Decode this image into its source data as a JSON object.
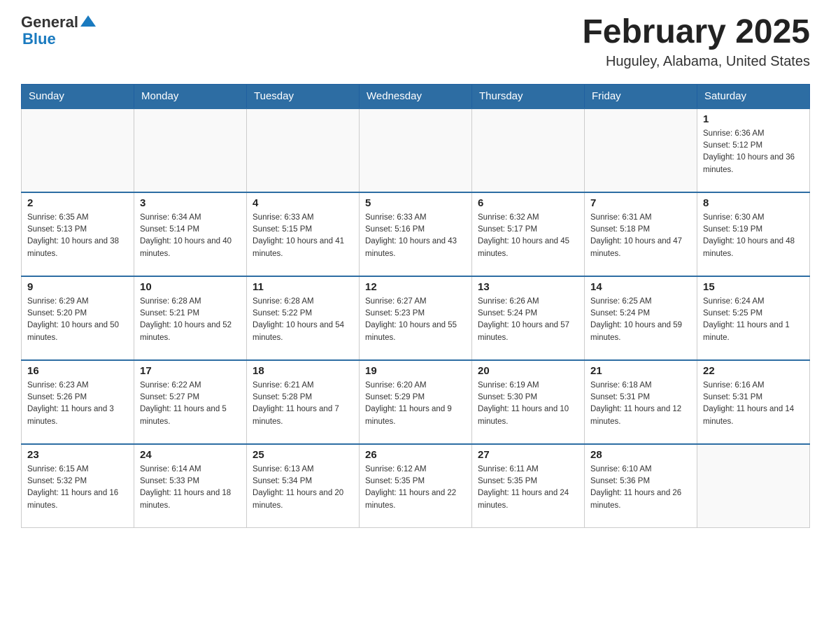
{
  "header": {
    "logo_general": "General",
    "logo_blue": "Blue",
    "month_title": "February 2025",
    "location": "Huguley, Alabama, United States"
  },
  "weekdays": [
    "Sunday",
    "Monday",
    "Tuesday",
    "Wednesday",
    "Thursday",
    "Friday",
    "Saturday"
  ],
  "weeks": [
    [
      {
        "day": "",
        "sunrise": "",
        "sunset": "",
        "daylight": ""
      },
      {
        "day": "",
        "sunrise": "",
        "sunset": "",
        "daylight": ""
      },
      {
        "day": "",
        "sunrise": "",
        "sunset": "",
        "daylight": ""
      },
      {
        "day": "",
        "sunrise": "",
        "sunset": "",
        "daylight": ""
      },
      {
        "day": "",
        "sunrise": "",
        "sunset": "",
        "daylight": ""
      },
      {
        "day": "",
        "sunrise": "",
        "sunset": "",
        "daylight": ""
      },
      {
        "day": "1",
        "sunrise": "Sunrise: 6:36 AM",
        "sunset": "Sunset: 5:12 PM",
        "daylight": "Daylight: 10 hours and 36 minutes."
      }
    ],
    [
      {
        "day": "2",
        "sunrise": "Sunrise: 6:35 AM",
        "sunset": "Sunset: 5:13 PM",
        "daylight": "Daylight: 10 hours and 38 minutes."
      },
      {
        "day": "3",
        "sunrise": "Sunrise: 6:34 AM",
        "sunset": "Sunset: 5:14 PM",
        "daylight": "Daylight: 10 hours and 40 minutes."
      },
      {
        "day": "4",
        "sunrise": "Sunrise: 6:33 AM",
        "sunset": "Sunset: 5:15 PM",
        "daylight": "Daylight: 10 hours and 41 minutes."
      },
      {
        "day": "5",
        "sunrise": "Sunrise: 6:33 AM",
        "sunset": "Sunset: 5:16 PM",
        "daylight": "Daylight: 10 hours and 43 minutes."
      },
      {
        "day": "6",
        "sunrise": "Sunrise: 6:32 AM",
        "sunset": "Sunset: 5:17 PM",
        "daylight": "Daylight: 10 hours and 45 minutes."
      },
      {
        "day": "7",
        "sunrise": "Sunrise: 6:31 AM",
        "sunset": "Sunset: 5:18 PM",
        "daylight": "Daylight: 10 hours and 47 minutes."
      },
      {
        "day": "8",
        "sunrise": "Sunrise: 6:30 AM",
        "sunset": "Sunset: 5:19 PM",
        "daylight": "Daylight: 10 hours and 48 minutes."
      }
    ],
    [
      {
        "day": "9",
        "sunrise": "Sunrise: 6:29 AM",
        "sunset": "Sunset: 5:20 PM",
        "daylight": "Daylight: 10 hours and 50 minutes."
      },
      {
        "day": "10",
        "sunrise": "Sunrise: 6:28 AM",
        "sunset": "Sunset: 5:21 PM",
        "daylight": "Daylight: 10 hours and 52 minutes."
      },
      {
        "day": "11",
        "sunrise": "Sunrise: 6:28 AM",
        "sunset": "Sunset: 5:22 PM",
        "daylight": "Daylight: 10 hours and 54 minutes."
      },
      {
        "day": "12",
        "sunrise": "Sunrise: 6:27 AM",
        "sunset": "Sunset: 5:23 PM",
        "daylight": "Daylight: 10 hours and 55 minutes."
      },
      {
        "day": "13",
        "sunrise": "Sunrise: 6:26 AM",
        "sunset": "Sunset: 5:24 PM",
        "daylight": "Daylight: 10 hours and 57 minutes."
      },
      {
        "day": "14",
        "sunrise": "Sunrise: 6:25 AM",
        "sunset": "Sunset: 5:24 PM",
        "daylight": "Daylight: 10 hours and 59 minutes."
      },
      {
        "day": "15",
        "sunrise": "Sunrise: 6:24 AM",
        "sunset": "Sunset: 5:25 PM",
        "daylight": "Daylight: 11 hours and 1 minute."
      }
    ],
    [
      {
        "day": "16",
        "sunrise": "Sunrise: 6:23 AM",
        "sunset": "Sunset: 5:26 PM",
        "daylight": "Daylight: 11 hours and 3 minutes."
      },
      {
        "day": "17",
        "sunrise": "Sunrise: 6:22 AM",
        "sunset": "Sunset: 5:27 PM",
        "daylight": "Daylight: 11 hours and 5 minutes."
      },
      {
        "day": "18",
        "sunrise": "Sunrise: 6:21 AM",
        "sunset": "Sunset: 5:28 PM",
        "daylight": "Daylight: 11 hours and 7 minutes."
      },
      {
        "day": "19",
        "sunrise": "Sunrise: 6:20 AM",
        "sunset": "Sunset: 5:29 PM",
        "daylight": "Daylight: 11 hours and 9 minutes."
      },
      {
        "day": "20",
        "sunrise": "Sunrise: 6:19 AM",
        "sunset": "Sunset: 5:30 PM",
        "daylight": "Daylight: 11 hours and 10 minutes."
      },
      {
        "day": "21",
        "sunrise": "Sunrise: 6:18 AM",
        "sunset": "Sunset: 5:31 PM",
        "daylight": "Daylight: 11 hours and 12 minutes."
      },
      {
        "day": "22",
        "sunrise": "Sunrise: 6:16 AM",
        "sunset": "Sunset: 5:31 PM",
        "daylight": "Daylight: 11 hours and 14 minutes."
      }
    ],
    [
      {
        "day": "23",
        "sunrise": "Sunrise: 6:15 AM",
        "sunset": "Sunset: 5:32 PM",
        "daylight": "Daylight: 11 hours and 16 minutes."
      },
      {
        "day": "24",
        "sunrise": "Sunrise: 6:14 AM",
        "sunset": "Sunset: 5:33 PM",
        "daylight": "Daylight: 11 hours and 18 minutes."
      },
      {
        "day": "25",
        "sunrise": "Sunrise: 6:13 AM",
        "sunset": "Sunset: 5:34 PM",
        "daylight": "Daylight: 11 hours and 20 minutes."
      },
      {
        "day": "26",
        "sunrise": "Sunrise: 6:12 AM",
        "sunset": "Sunset: 5:35 PM",
        "daylight": "Daylight: 11 hours and 22 minutes."
      },
      {
        "day": "27",
        "sunrise": "Sunrise: 6:11 AM",
        "sunset": "Sunset: 5:35 PM",
        "daylight": "Daylight: 11 hours and 24 minutes."
      },
      {
        "day": "28",
        "sunrise": "Sunrise: 6:10 AM",
        "sunset": "Sunset: 5:36 PM",
        "daylight": "Daylight: 11 hours and 26 minutes."
      },
      {
        "day": "",
        "sunrise": "",
        "sunset": "",
        "daylight": ""
      }
    ]
  ]
}
